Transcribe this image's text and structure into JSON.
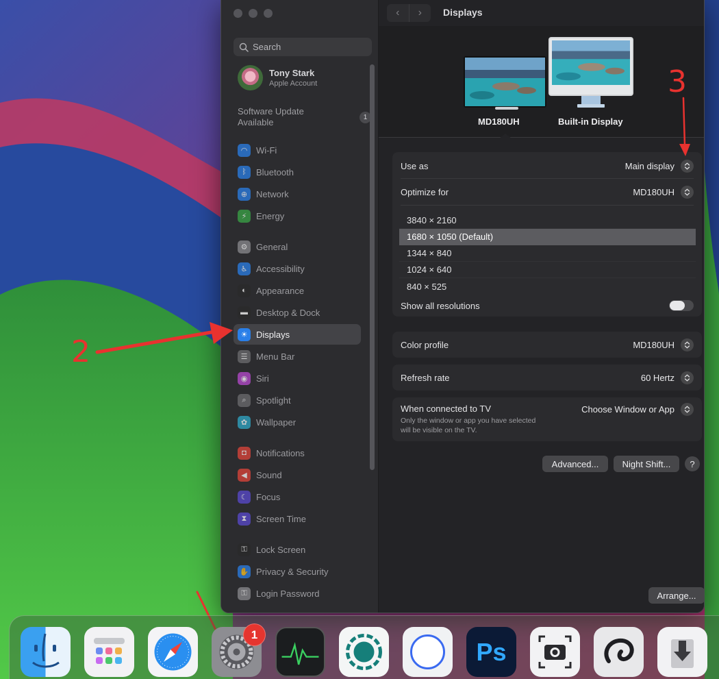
{
  "window": {
    "title": "Displays",
    "back_glyph": "‹",
    "forward_glyph": "›"
  },
  "sidebar": {
    "search_placeholder": "Search",
    "account": {
      "name": "Tony Stark",
      "subtitle": "Apple Account"
    },
    "software_update": {
      "line1": "Software Update",
      "line2": "Available",
      "badge": "1"
    },
    "items": [
      {
        "label": "Wi-Fi",
        "icon": "wifi-icon",
        "color": "#2a7fe8",
        "glyph": "◠"
      },
      {
        "label": "Bluetooth",
        "icon": "bluetooth-icon",
        "color": "#2a7fe8",
        "glyph": "ᛒ"
      },
      {
        "label": "Network",
        "icon": "network-icon",
        "color": "#2a7fe8",
        "glyph": "⊕"
      },
      {
        "label": "Energy",
        "icon": "energy-icon",
        "color": "#3aa546",
        "glyph": "⚡"
      },
      {
        "label": "General",
        "icon": "gear-icon",
        "color": "#8a8a8e",
        "glyph": "⚙"
      },
      {
        "label": "Accessibility",
        "icon": "accessibility-icon",
        "color": "#2a7fe8",
        "glyph": "♿"
      },
      {
        "label": "Appearance",
        "icon": "appearance-icon",
        "color": "#2a2a2a",
        "glyph": "◐"
      },
      {
        "label": "Desktop & Dock",
        "icon": "desktop-dock-icon",
        "color": "#2a2a2a",
        "glyph": "▬"
      },
      {
        "label": "Displays",
        "icon": "displays-icon",
        "color": "#2a7fe8",
        "glyph": "☀"
      },
      {
        "label": "Menu Bar",
        "icon": "menu-bar-icon",
        "color": "#6c6c70",
        "glyph": "☰"
      },
      {
        "label": "Siri",
        "icon": "siri-icon",
        "color": "#b84ad0",
        "glyph": "◉"
      },
      {
        "label": "Spotlight",
        "icon": "spotlight-icon",
        "color": "#6c6c70",
        "glyph": "⌕"
      },
      {
        "label": "Wallpaper",
        "icon": "wallpaper-icon",
        "color": "#2fa9c8",
        "glyph": "✿"
      },
      {
        "label": "Notifications",
        "icon": "notifications-icon",
        "color": "#e0443a",
        "glyph": "◘"
      },
      {
        "label": "Sound",
        "icon": "sound-icon",
        "color": "#e0443a",
        "glyph": "◀"
      },
      {
        "label": "Focus",
        "icon": "focus-icon",
        "color": "#5a4ad0",
        "glyph": "☾"
      },
      {
        "label": "Screen Time",
        "icon": "screen-time-icon",
        "color": "#5a4ad0",
        "glyph": "⧗"
      },
      {
        "label": "Lock Screen",
        "icon": "lock-icon",
        "color": "#2a2a2a",
        "glyph": "⚿"
      },
      {
        "label": "Privacy & Security",
        "icon": "privacy-hand-icon",
        "color": "#2a7fe8",
        "glyph": "✋"
      },
      {
        "label": "Login Password",
        "icon": "login-password-icon",
        "color": "#8a8a8e",
        "glyph": "⚿"
      }
    ],
    "active": "Displays"
  },
  "displays": {
    "external_name": "MD180UH",
    "builtin_name": "Built-in Display",
    "use_as": {
      "label": "Use as",
      "value": "Main display"
    },
    "optimize_for": {
      "label": "Optimize for",
      "value": "MD180UH"
    },
    "resolutions": [
      "3840 × 2160",
      "1680 × 1050 (Default)",
      "1344 × 840",
      "1024 × 640",
      "840 × 525"
    ],
    "selected_resolution": "1680 × 1050 (Default)",
    "show_all": {
      "label": "Show all resolutions",
      "on": false
    },
    "color_profile": {
      "label": "Color profile",
      "value": "MD180UH"
    },
    "refresh_rate": {
      "label": "Refresh rate",
      "value": "60 Hertz"
    },
    "tv": {
      "label": "When connected to TV",
      "value": "Choose Window or App",
      "help_line1": "Only the window or app you have selected",
      "help_line2": "will be visible on the TV."
    },
    "buttons": {
      "advanced": "Advanced...",
      "night_shift": "Night Shift...",
      "help": "?",
      "arrange": "Arrange..."
    }
  },
  "annotations": {
    "step2": "2",
    "step3": "3"
  },
  "dock": {
    "apps": [
      "finder-icon",
      "launchpad-icon",
      "safari-icon",
      "system-settings-icon",
      "activity-monitor-icon",
      "screen-recorder-icon",
      "circle-app-icon",
      "photoshop-icon",
      "screenshot-icon",
      "clip-studio-icon",
      "downloads-icon"
    ],
    "photoshop_label": "Ps",
    "settings_badge": "1"
  },
  "colors": {
    "accent_annotation": "#e8322f",
    "selection": "#5c5c60"
  }
}
